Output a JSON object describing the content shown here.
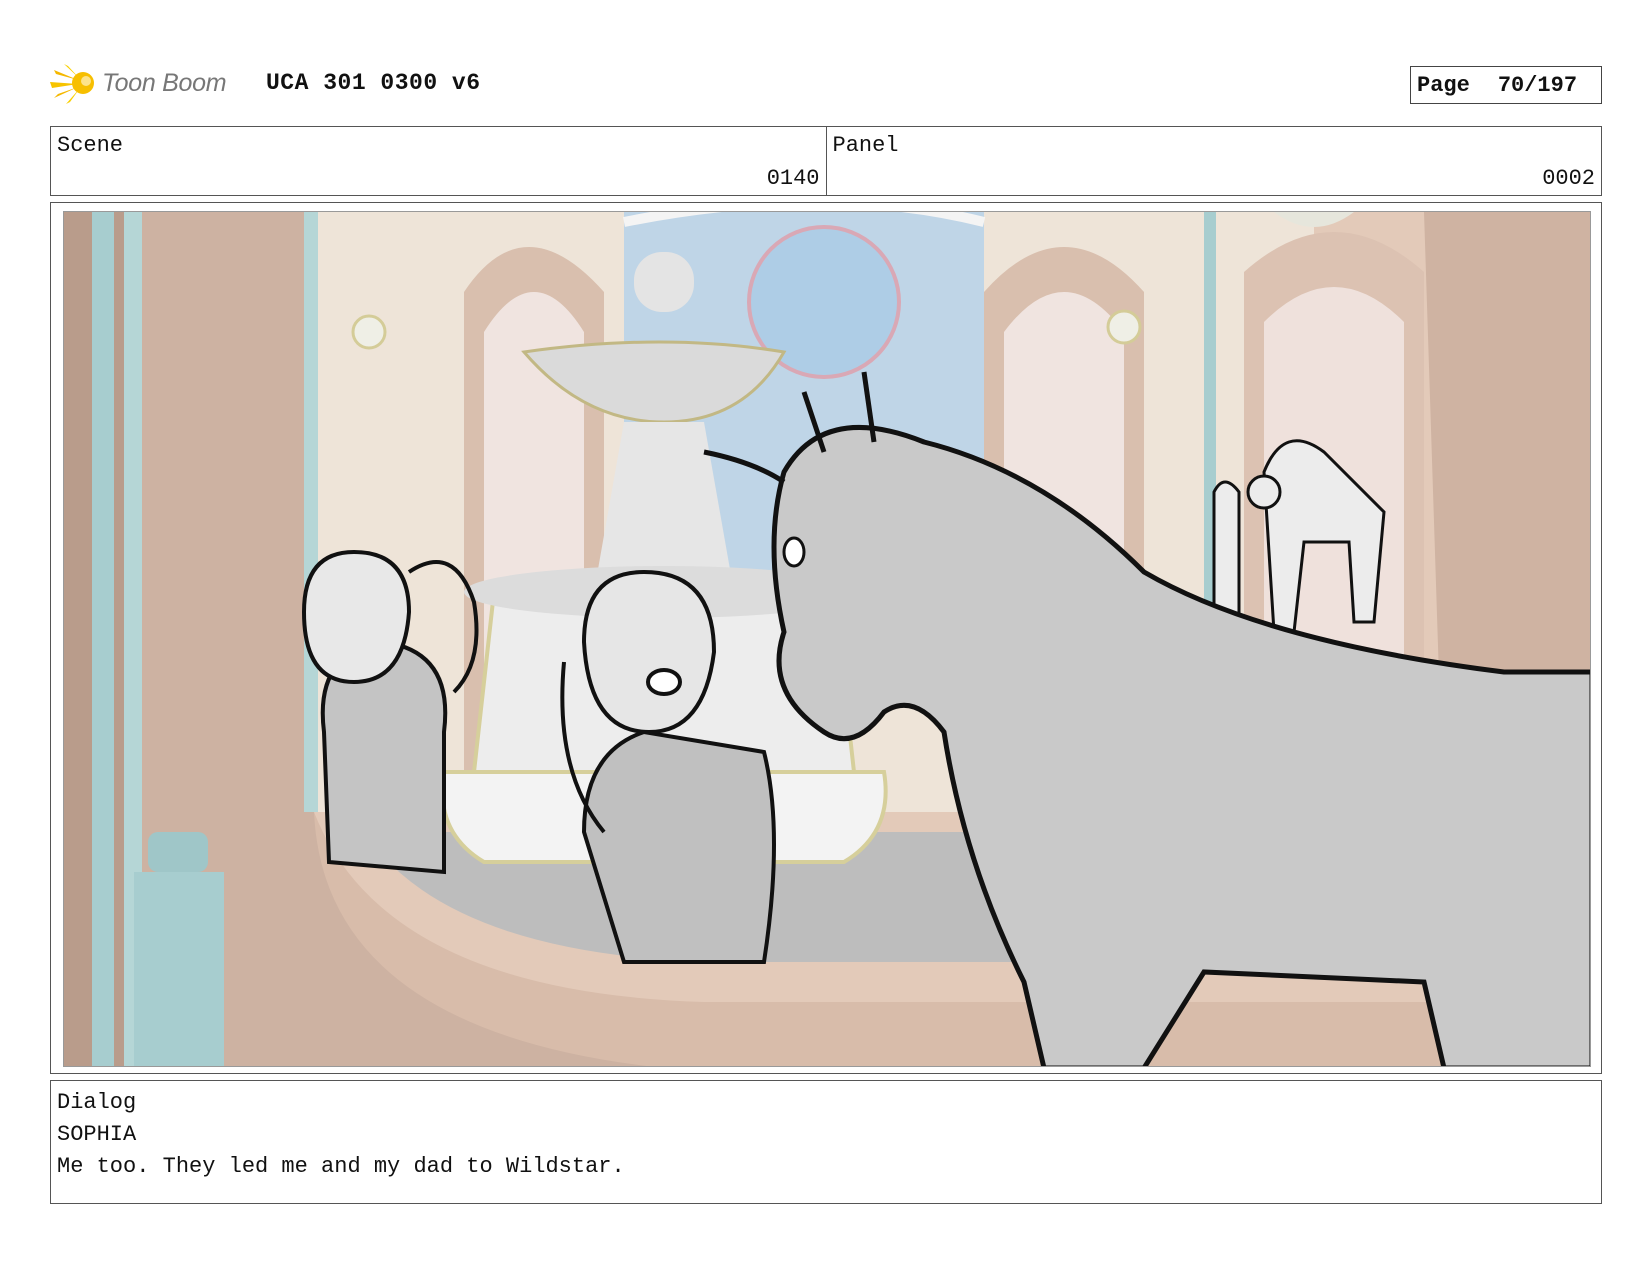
{
  "header": {
    "logo_text": "Toon Boom",
    "title": "UCA 301 0300 v6",
    "page_label": "Page",
    "page_number": "70/197"
  },
  "meta": {
    "scene_label": "Scene",
    "scene_value": "0140",
    "panel_label": "Panel",
    "panel_value": "0002"
  },
  "dialog": {
    "label": "Dialog",
    "character": "SOPHIA",
    "line": "Me too. They led me and my dad to Wildstar."
  },
  "colors": {
    "logo_yellow": "#f5b800",
    "logo_text": "#777777",
    "wall": "#e0c6b6",
    "pillar": "#a9cfd0",
    "horse": "#c8c8c8",
    "sky": "#bcd3e6"
  },
  "icons": {
    "logo": "toon-boom-star-icon"
  }
}
